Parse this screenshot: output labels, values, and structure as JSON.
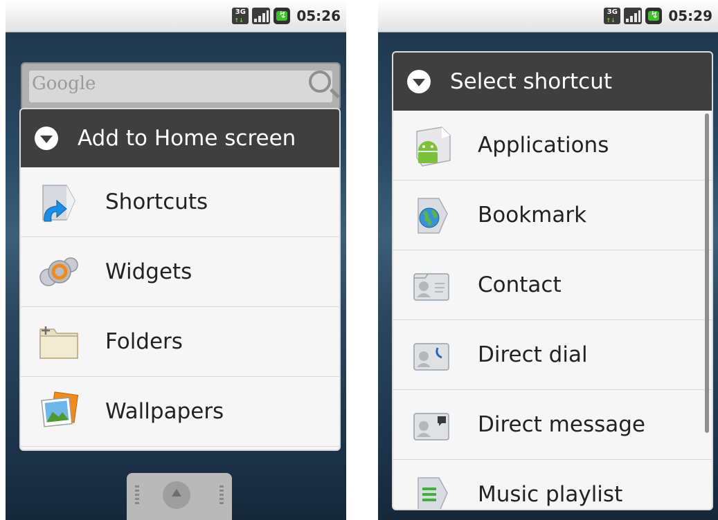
{
  "left_screen": {
    "status_bar": {
      "network": "3G",
      "time": "05:26"
    },
    "search_bar": {
      "placeholder": "Google"
    },
    "dialog": {
      "title": "Add to Home screen",
      "items": [
        {
          "label": "Shortcuts",
          "icon": "shortcut-icon"
        },
        {
          "label": "Widgets",
          "icon": "widgets-gear-icon"
        },
        {
          "label": "Folders",
          "icon": "folder-icon"
        },
        {
          "label": "Wallpapers",
          "icon": "wallpapers-icon"
        }
      ]
    }
  },
  "right_screen": {
    "status_bar": {
      "network": "3G",
      "time": "05:29"
    },
    "dialog": {
      "title": "Select shortcut",
      "items": [
        {
          "label": "Applications",
          "icon": "android-applications-icon"
        },
        {
          "label": "Bookmark",
          "icon": "bookmark-globe-icon"
        },
        {
          "label": "Contact",
          "icon": "contact-card-icon"
        },
        {
          "label": "Direct dial",
          "icon": "direct-dial-icon"
        },
        {
          "label": "Direct message",
          "icon": "direct-message-icon"
        },
        {
          "label": "Music playlist",
          "icon": "music-playlist-icon"
        }
      ]
    }
  },
  "colors": {
    "dialog_header": "#3f3f3f",
    "dialog_body": "#f6f6f6",
    "wallpaper": "#2a4a64",
    "battery_green": "#3fbf2c"
  }
}
